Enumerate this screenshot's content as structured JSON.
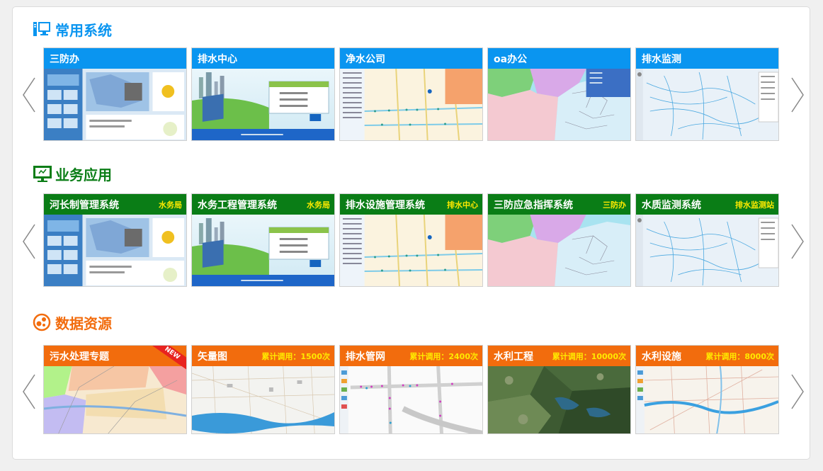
{
  "colors": {
    "blue": "#0a95f0",
    "green": "#0a7d16",
    "orange": "#f26c0d",
    "tag_yellow": "#ffea00"
  },
  "sections": [
    {
      "title": "常用系统",
      "icon": "computer-icon",
      "cards": [
        {
          "name": "三防办",
          "tag": "",
          "thumb": "dashboard-screenshot"
        },
        {
          "name": "排水中心",
          "tag": "",
          "thumb": "login-screenshot"
        },
        {
          "name": "净水公司",
          "tag": "",
          "thumb": "pipe-map-screenshot"
        },
        {
          "name": "oa办公",
          "tag": "",
          "thumb": "district-map-screenshot"
        },
        {
          "name": "排水监测",
          "tag": "",
          "thumb": "river-map-screenshot"
        }
      ]
    },
    {
      "title": "业务应用",
      "icon": "monitor-icon",
      "cards": [
        {
          "name": "河长制管理系统",
          "tag": "水务局",
          "thumb": "dashboard-screenshot"
        },
        {
          "name": "水务工程管理系统",
          "tag": "水务局",
          "thumb": "login-screenshot"
        },
        {
          "name": "排水设施管理系统",
          "tag": "排水中心",
          "thumb": "pipe-map-screenshot"
        },
        {
          "name": "三防应急指挥系统",
          "tag": "三防办",
          "thumb": "district-map-screenshot"
        },
        {
          "name": "水质监测系统",
          "tag": "排水监测站",
          "thumb": "river-map-screenshot"
        }
      ]
    },
    {
      "title": "数据资源",
      "icon": "data-icon",
      "badge": "NEW",
      "cards": [
        {
          "name": "污水处理专题",
          "tag": "",
          "thumb": "color-region-map"
        },
        {
          "name": "矢量图",
          "tag": "累计调用：1500次",
          "thumb": "vector-map"
        },
        {
          "name": "排水管网",
          "tag": "累计调用：2400次",
          "thumb": "network-map"
        },
        {
          "name": "水利工程",
          "tag": "累计调用：10000次",
          "thumb": "satellite-map"
        },
        {
          "name": "水利设施",
          "tag": "累计调用：8000次",
          "thumb": "facility-map"
        }
      ]
    }
  ]
}
